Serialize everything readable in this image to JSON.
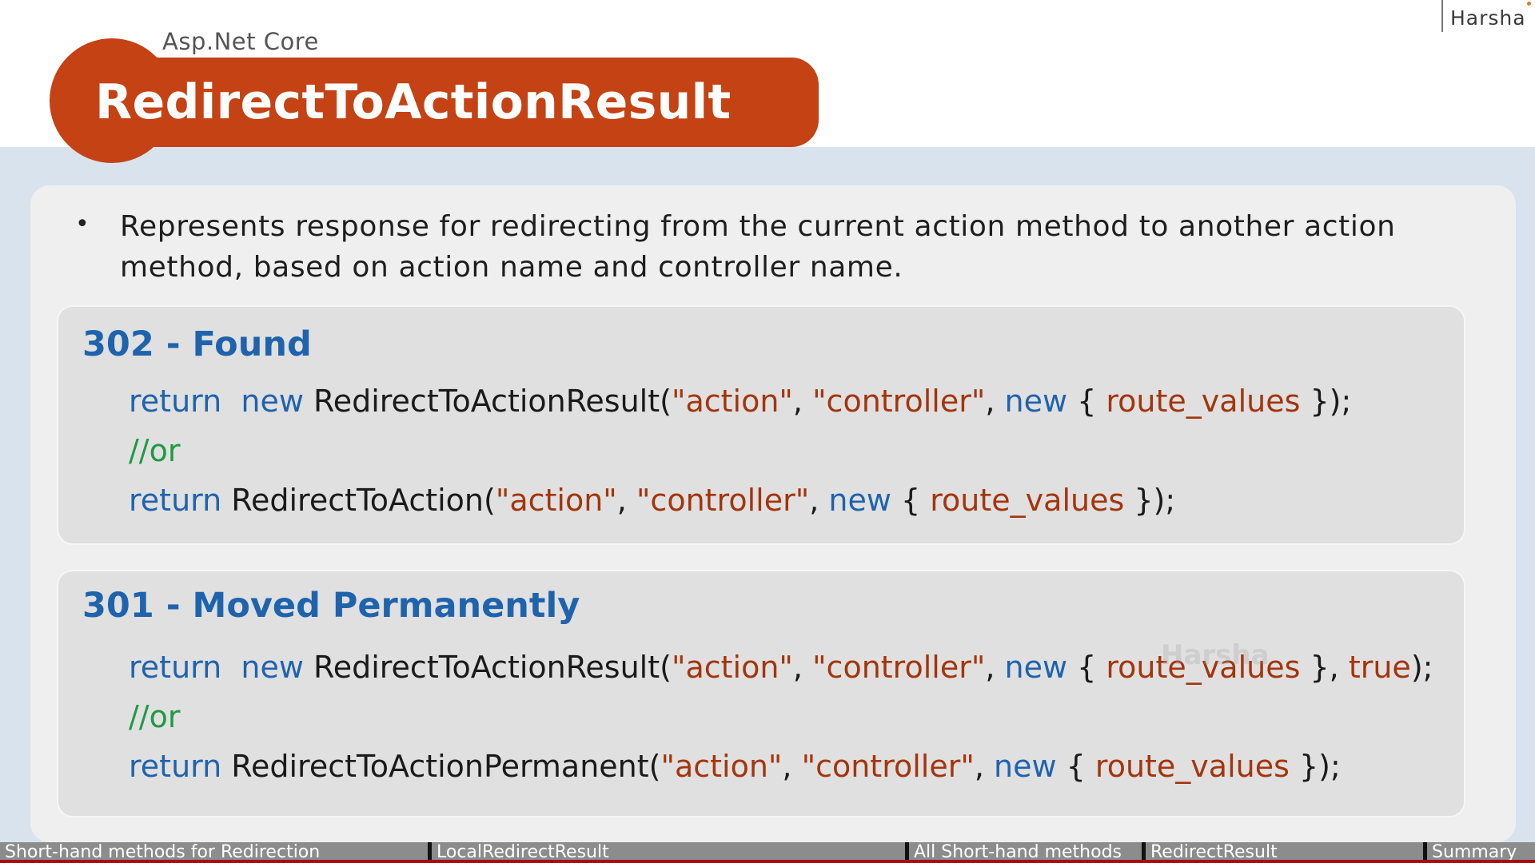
{
  "header": {
    "author": "Harsha",
    "subtitle": "Asp.Net Core",
    "title": "RedirectToActionResult"
  },
  "content": {
    "bullet": "Represents response for redirecting from the current action method to another action method, based on action name and controller name."
  },
  "code_boxes": [
    {
      "heading": "302 - Found",
      "line1": {
        "kw1": "return",
        "kw2": "new",
        "method": " RedirectToActionResult(",
        "s1": "\"action\"",
        "c1": ", ",
        "s2": "\"controller\"",
        "c2": ", ",
        "kw3": "new",
        "c3": " { ",
        "rv": "route_values",
        "end": " });"
      },
      "comment": "//or",
      "line3": {
        "kw1": "return",
        "method": " RedirectToAction(",
        "s1": "\"action\"",
        "c1": ", ",
        "s2": "\"controller\"",
        "c2": ", ",
        "kw2": "new",
        "c3": " { ",
        "rv": "route_values",
        "end": " });"
      }
    },
    {
      "heading": "301 - Moved Permanently",
      "line1": {
        "kw1": "return",
        "kw2": "new",
        "method": " RedirectToActionResult(",
        "s1": "\"action\"",
        "c1": ", ",
        "s2": "\"controller\"",
        "c2": ", ",
        "kw3": "new",
        "c3": " { ",
        "rv": "route_values",
        "c4": " }, ",
        "tr": "true",
        "end": ");"
      },
      "comment": "//or",
      "line3": {
        "kw1": "return",
        "method": " RedirectToActionPermanent(",
        "s1": "\"action\"",
        "c1": ", ",
        "s2": "\"controller\"",
        "c2": ", ",
        "kw2": "new",
        "c3": " { ",
        "rv": "route_values",
        "end": " });"
      }
    }
  ],
  "watermark": "Harsha",
  "nav": {
    "items": [
      "Short-hand methods for Redirection",
      "LocalRedirectResult",
      "All Short-hand methods",
      "RedirectResult",
      "Summary"
    ]
  },
  "colors": {
    "title_bg": "#c44213",
    "keyword": "#1f63ad",
    "string": "#a3350d",
    "comment": "#1f9a44",
    "nav_bg": "#8c8c8c",
    "progress": "#a50d0d"
  }
}
